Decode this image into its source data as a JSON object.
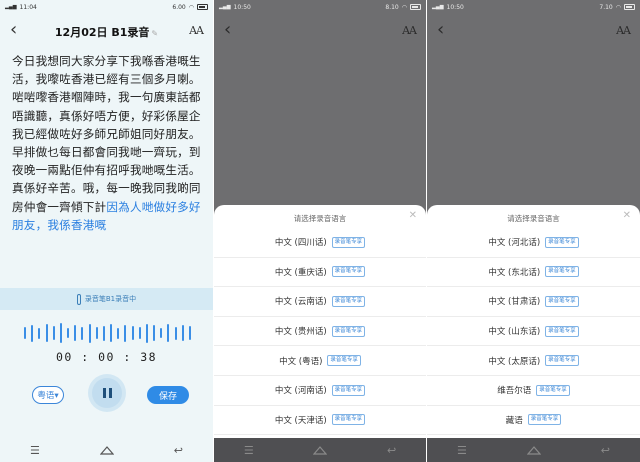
{
  "screen1": {
    "status": {
      "time": "11:04",
      "right": "6.00"
    },
    "title": "12月02日 B1录音",
    "font_button": "AA",
    "transcript_main": "今日我想同大家分享下我喺香港嘅生活，我嚟咗香港已經有三個多月喇。啱啱嚟香港嗰陣時，我一句廣東話都唔識聽，真係好唔方便，好彩係屋企我已經做咗好多師兄師姐同好朋友。早排做乜每日都會同我哋一齊玩，到夜晚一兩點佢仲有招呼我哋嘅生活。真係好辛苦。哦，每一晚我同我啲同房仲會一齊傾下計",
    "transcript_highlight": "因為人哋做好多好朋友，我係香港嘅",
    "recording_bar": "录音笔B1录音中",
    "timer": "00 : 00 : 38",
    "language_button": "粤语▾",
    "save_button": "保存",
    "waveform_levels": [
      0.6,
      0.85,
      0.55,
      0.9,
      0.7,
      1.0,
      0.5,
      0.8,
      0.65,
      0.95,
      0.6,
      0.75,
      0.9,
      0.55,
      0.85,
      0.7,
      0.6,
      0.95,
      0.8,
      0.5,
      0.9,
      0.65,
      0.8,
      0.7
    ]
  },
  "screen2": {
    "status": {
      "time": "10:50",
      "right": "8.10"
    },
    "font_button": "AA",
    "sheet_title": "请选择录音语言",
    "languages": [
      {
        "name": "中文 (四川话)",
        "tag": "录音笔专享"
      },
      {
        "name": "中文 (重庆话)",
        "tag": "录音笔专享"
      },
      {
        "name": "中文 (云南话)",
        "tag": "录音笔专享"
      },
      {
        "name": "中文 (贵州话)",
        "tag": "录音笔专享"
      },
      {
        "name": "中文 (粤语)",
        "tag": "录音笔专享"
      },
      {
        "name": "中文 (河南话)",
        "tag": "录音笔专享"
      },
      {
        "name": "中文 (天津话)",
        "tag": "录音笔专享"
      }
    ]
  },
  "screen3": {
    "status": {
      "time": "10:50",
      "right": "7.10"
    },
    "font_button": "AA",
    "sheet_title": "请选择录音语言",
    "languages": [
      {
        "name": "中文 (河北话)",
        "tag": "录音笔专享"
      },
      {
        "name": "中文 (东北话)",
        "tag": "录音笔专享"
      },
      {
        "name": "中文 (甘肃话)",
        "tag": "录音笔专享"
      },
      {
        "name": "中文 (山东话)",
        "tag": "录音笔专享"
      },
      {
        "name": "中文 (太原话)",
        "tag": "录音笔专享"
      },
      {
        "name": "维吾尔语",
        "tag": "录音笔专享"
      },
      {
        "name": "藏语",
        "tag": "录音笔专享"
      }
    ]
  },
  "colors": {
    "accent": "#2f8be6",
    "sheet_overlay": "#6e6e70",
    "recording_bar": "#d5eaf4"
  }
}
